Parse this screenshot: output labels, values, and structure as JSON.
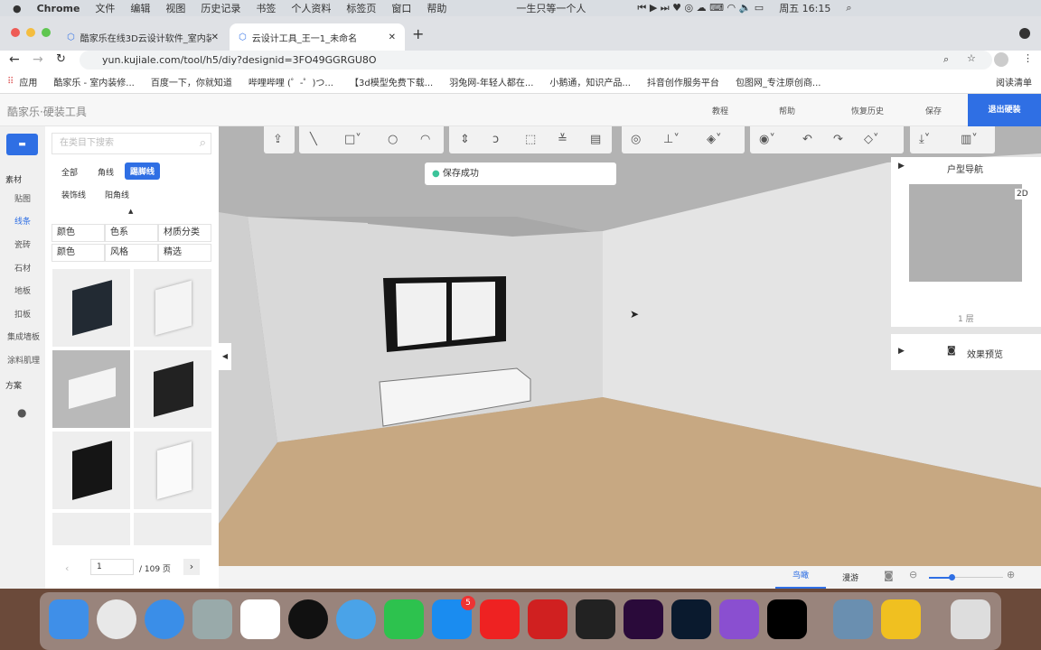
{
  "menubar": {
    "app": "Chrome",
    "items": [
      "文件",
      "编辑",
      "视图",
      "历史记录",
      "书签",
      "个人资料",
      "标签页",
      "窗口",
      "帮助"
    ],
    "now_playing": "一生只等一个人",
    "clock": "周五 16:15"
  },
  "tabs": [
    {
      "title": "酷家乐在线3D云设计软件_室内装"
    },
    {
      "title": "云设计工具_王一1_未命名"
    }
  ],
  "address": {
    "url": "yun.kujiale.com/tool/h5/diy?designid=3FO49GGRGU8O"
  },
  "bookmarks": [
    "应用",
    "酷家乐 - 室内装修...",
    "百度一下，你就知道",
    "哔哩哔哩 (゜-゜)つ...",
    "【3d模型免费下载...",
    "羽兔网-年轻人都在...",
    "小鹅通，知识产品...",
    "抖音创作服务平台",
    "包图网_专注原创商..."
  ],
  "reading_list": "阅读清单",
  "app": {
    "logo": "酷家乐·硬装工具",
    "tutorial": "教程",
    "help": "帮助",
    "history": "恢复历史",
    "save": "保存",
    "exit": "退出硬装"
  },
  "leftnav": {
    "section1": "素材",
    "items": [
      "贴图",
      "线条",
      "瓷砖",
      "石材",
      "地板",
      "扣板",
      "集成墙板",
      "涂料肌理"
    ],
    "active": "线条",
    "section2": "方案"
  },
  "panel": {
    "search_placeholder": "在类目下搜索",
    "chips": [
      "全部",
      "角线",
      "踢脚线",
      "装饰线",
      "阳角线"
    ],
    "active_chip": "踢脚线",
    "filters": [
      "颜色",
      "色系",
      "材质分类",
      "颜色",
      "风格",
      "精选"
    ],
    "page": "1",
    "total": "/ 109 页"
  },
  "toast": "保存成功",
  "nav_panel": {
    "title": "户型导航",
    "mode": "2D",
    "floor": "1 层",
    "preview": "效果预览"
  },
  "bottom": {
    "bird": "鸟瞰",
    "walk": "漫游",
    "zoom_level": 0.1
  },
  "accent": "#2f6fe4",
  "dock_badge": "5"
}
